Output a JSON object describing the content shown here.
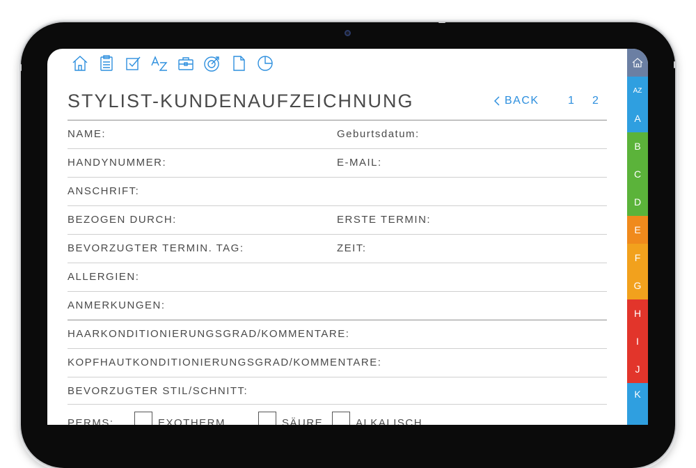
{
  "toolbar": {
    "icons": [
      "home-icon",
      "clipboard-icon",
      "checkbox-icon",
      "az-sort-icon",
      "briefcase-icon",
      "target-icon",
      "document-icon",
      "pie-chart-icon"
    ]
  },
  "header": {
    "title": "STYLIST-KUNDENAUFZEICHNUNG",
    "back_label": "BACK",
    "pages": [
      "1",
      "2"
    ]
  },
  "form": {
    "name": "NAME:",
    "birthdate": "Geburtsdatum:",
    "phone": "HANDYNUMMER:",
    "email": "E-MAIL:",
    "address": "ANSCHRIFT:",
    "referred_by": "BEZOGEN DURCH:",
    "first_appointment": "ERSTE TERMIN:",
    "preferred_day": "BEVORZUGTER TERMIN. TAG:",
    "time": "ZEIT:",
    "allergies": "ALLERGIEN:",
    "notes": "ANMERKUNGEN:",
    "hair_condition": "HAARKONDITIONIERUNGSGRAD/KOMMENTARE:",
    "scalp_condition": "KOPFHAUTKONDITIONIERUNGSGRAD/KOMMENTARE:",
    "preferred_style": "BEVORZUGTER STIL/SCHNITT:",
    "perms_label": "PERMS:",
    "perm_options": [
      "EXOTHERM",
      "SÄURE",
      "ALKALISCH"
    ]
  },
  "tabs": {
    "home": "⌂",
    "az": "AZ",
    "letters": [
      "A",
      "B",
      "C",
      "D",
      "E",
      "F",
      "G",
      "H",
      "I",
      "J",
      "K"
    ]
  },
  "colors": {
    "accent": "#2d8fde",
    "tab_home": "#6b7fa3",
    "tab_az": "#2f9fe0",
    "tab_A": "#2f9fe0",
    "tab_B": "#5bb33a",
    "tab_C": "#5bb33a",
    "tab_D": "#5bb33a",
    "tab_E": "#f08a1c",
    "tab_F": "#f2a11d",
    "tab_G": "#f2a11d",
    "tab_H": "#e2352b",
    "tab_I": "#e2352b",
    "tab_J": "#e2352b",
    "tab_K": "#2f9fe0"
  }
}
